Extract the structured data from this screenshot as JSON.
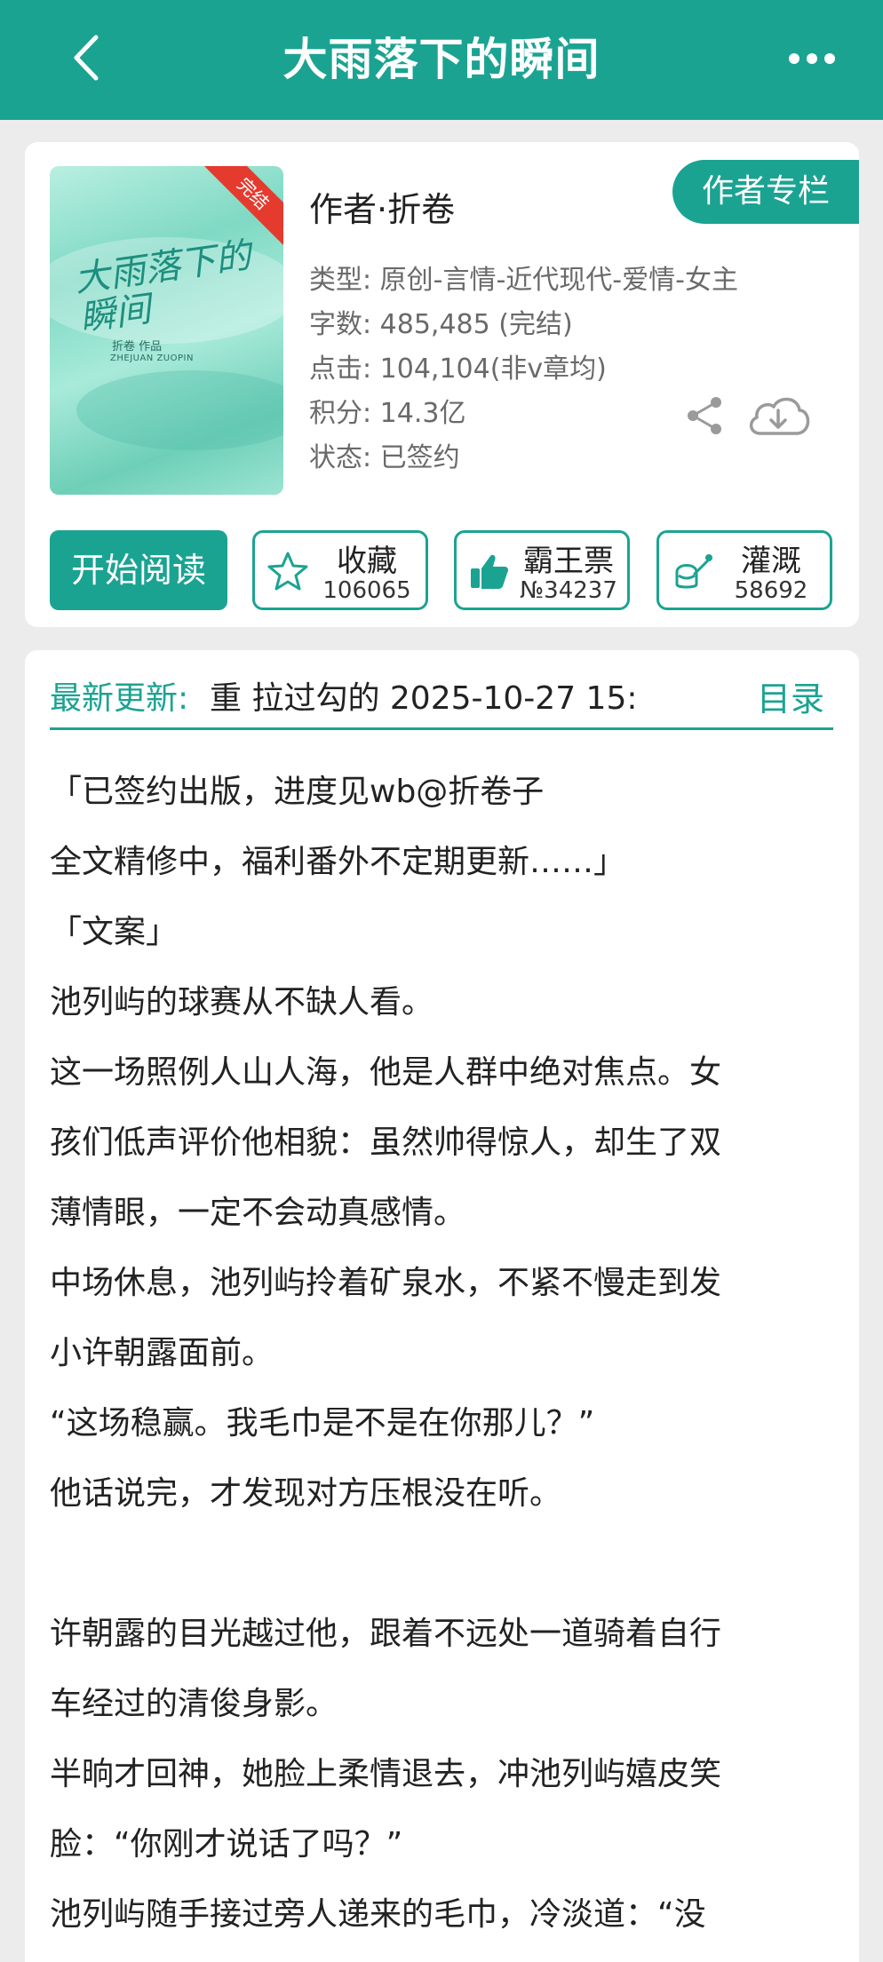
{
  "header": {
    "title": "大雨落下的瞬间"
  },
  "book": {
    "cover_title": "大雨落下的瞬间",
    "cover_author": "折卷 作品",
    "cover_pinyin": "ZHEJUAN ZUOPIN",
    "cover_badge": "完结",
    "author_line": "作者·折卷",
    "column_button": "作者专栏",
    "info": [
      "类型: 原创-言情-近代现代-爱情-女主",
      "字数: 485,485 (完结)",
      "点击: 104,104(非v章均)",
      "积分: 14.3亿",
      "状态: 已签约"
    ]
  },
  "actions": {
    "read_label": "开始阅读",
    "favorite": {
      "label": "收藏",
      "count": "106065"
    },
    "bawangpiao": {
      "label": "霸王票",
      "count": "№34237"
    },
    "water": {
      "label": "灌溉",
      "count": "58692"
    }
  },
  "update": {
    "label": "最新更新:",
    "text": "重  拉过勾的  2025-10-27 15:",
    "catalog": "目录"
  },
  "description": [
    "「已签约出版，进度见wb@折卷子",
    "全文精修中，福利番外不定期更新……」",
    "「文案」",
    "池列屿的球赛从不缺人看。",
    "这一场照例人山人海，他是人群中绝对焦点。女",
    "孩们低声评价他相貌：虽然帅得惊人，却生了双",
    "薄情眼，一定不会动真感情。",
    "中场休息，池列屿拎着矿泉水，不紧不慢走到发",
    "小许朝露面前。",
    "“这场稳赢。我毛巾是不是在你那儿？”",
    "他话说完，才发现对方压根没在听。",
    "",
    "许朝露的目光越过他，跟着不远处一道骑着自行",
    "车经过的清俊身影。",
    "半晌才回神，她脸上柔情退去，冲池列屿嬉皮笑",
    "脸：“你刚才说话了吗？”",
    "池列屿随手接过旁人递来的毛巾，冷淡道：“没"
  ],
  "colors": {
    "accent": "#1ba392",
    "badge": "#e53a2e"
  },
  "icons": [
    "back-icon",
    "more-icon",
    "share-icon",
    "download-icon",
    "star-icon",
    "thumb-up-icon",
    "watering-can-icon"
  ]
}
